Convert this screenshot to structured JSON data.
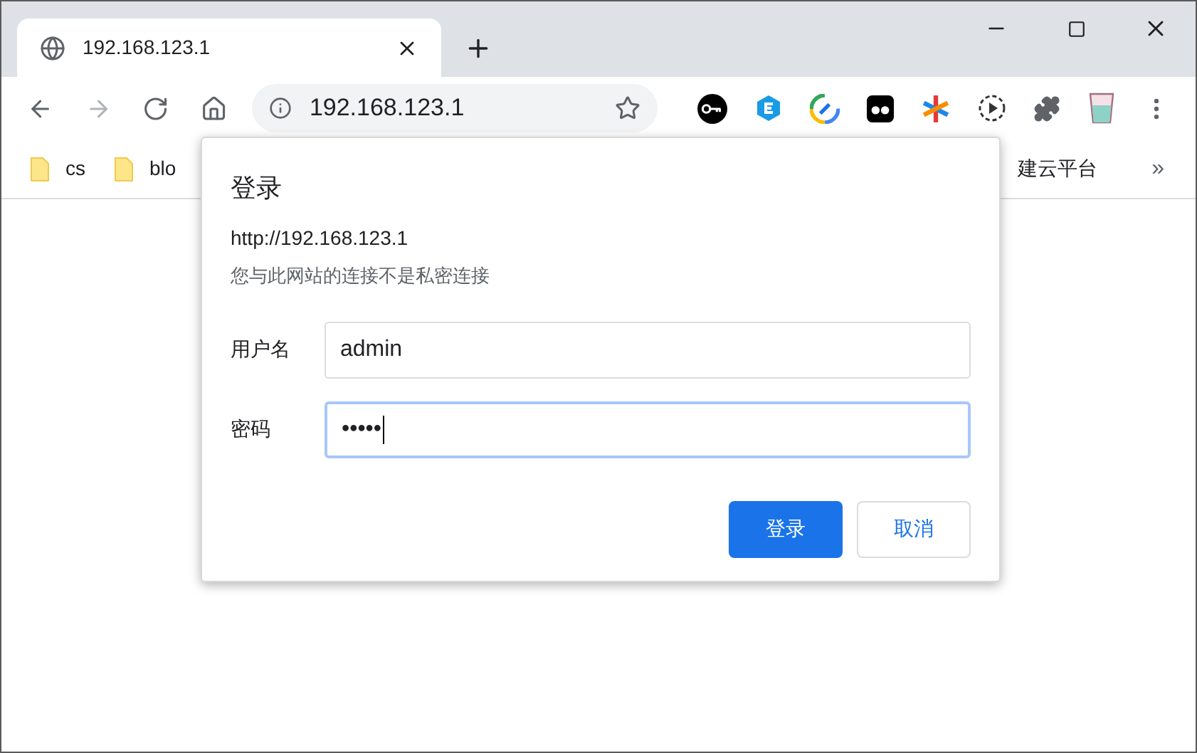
{
  "tabs": [
    {
      "title": "192.168.123.1",
      "selected": true
    }
  ],
  "nav": [
    {
      "kind": "back",
      "disabled": false
    },
    {
      "kind": "forward",
      "disabled": true
    },
    {
      "kind": "reload",
      "disabled": false
    },
    {
      "kind": "home",
      "disabled": false
    }
  ],
  "address": {
    "url": "192.168.123.1"
  },
  "bookmarks": [
    {
      "label": "cs"
    },
    {
      "label": "blo"
    }
  ],
  "bookmarks_right": {
    "label": "建云平台",
    "more": "»"
  },
  "dialog": {
    "title": "登录",
    "origin": "http://192.168.123.1",
    "warning": "您与此网站的连接不是私密连接",
    "fields": [
      {
        "label": "用户名",
        "value": "admin",
        "focused": false
      },
      {
        "label": "密码",
        "value": "•••••",
        "focused": true
      }
    ],
    "buttons": [
      {
        "label": "登录",
        "kind": "primary"
      },
      {
        "label": "取消",
        "kind": "secondary"
      }
    ]
  }
}
